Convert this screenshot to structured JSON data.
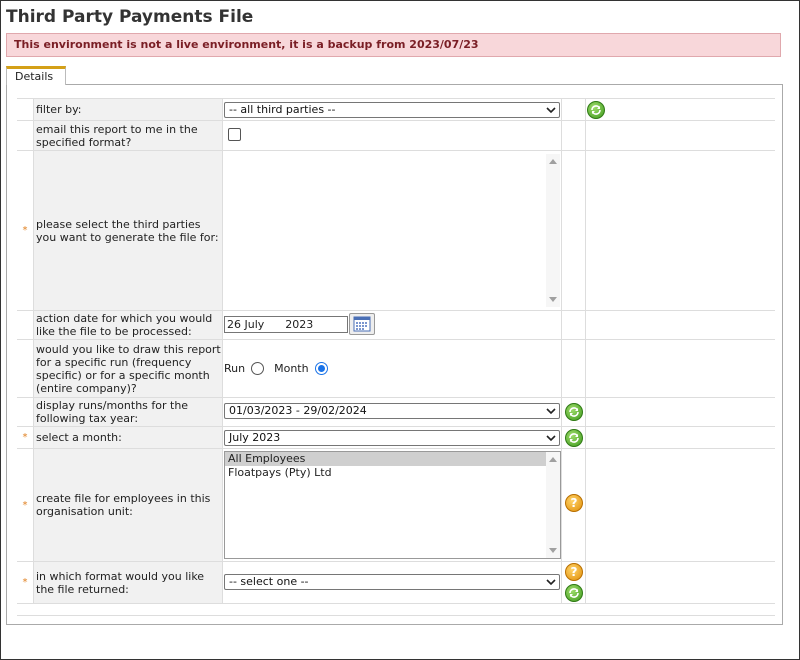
{
  "page": {
    "title": "Third Party Payments File"
  },
  "banner": {
    "text": "This environment is not a live environment, it is a backup from 2023/07/23"
  },
  "tabs": [
    {
      "label": "Details"
    }
  ],
  "form": {
    "filter_by": {
      "label": "filter by:",
      "value": "-- all third parties --"
    },
    "email_report": {
      "label": "email this report to me in the specified format?",
      "checked": false
    },
    "third_parties": {
      "label": "please select the third parties you want to generate the file for:",
      "required": true
    },
    "action_date": {
      "label": "action date for which you would like the file to be processed:",
      "value": "26 July      2023"
    },
    "draw_mode": {
      "label": "would you like to draw this report for a specific run (frequency specific) or for a specific month (entire company)?",
      "options": [
        {
          "label": "Run",
          "selected": false
        },
        {
          "label": "Month",
          "selected": true
        }
      ]
    },
    "tax_year": {
      "label": "display runs/months for the following tax year:",
      "value": "01/03/2023 - 29/02/2024"
    },
    "month": {
      "label": "select a month:",
      "value": "July 2023",
      "required": true
    },
    "org_unit": {
      "label": "create file for employees in this organisation unit:",
      "required": true,
      "options": [
        {
          "label": "All Employees",
          "selected": true
        },
        {
          "label": "Floatpays (Pty) Ltd",
          "selected": false
        }
      ]
    },
    "format": {
      "label": "in which format would you like the file returned:",
      "value": "-- select one --",
      "required": true
    }
  },
  "required_marker": "*",
  "icons": {
    "refresh": "refresh-icon",
    "help": "help-icon",
    "calendar": "calendar-icon"
  },
  "colors": {
    "banner_bg": "#f8d7da",
    "banner_text": "#7a1e25",
    "refresh": "#3e9a1d",
    "help": "#e08d07",
    "tab_accent": "#d4a017"
  }
}
